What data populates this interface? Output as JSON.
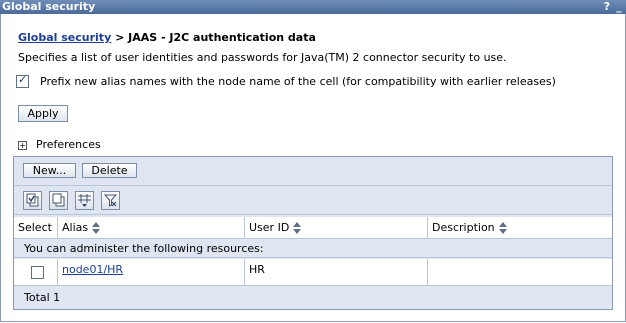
{
  "window": {
    "title": "Global security",
    "help_icon": "?",
    "minimize_icon": "_"
  },
  "breadcrumb": {
    "link": "Global security",
    "separator": " > ",
    "current": "JAAS - J2C authentication data"
  },
  "description": "Specifies a list of user identities and passwords for Java(TM) 2 connector security to use.",
  "prefix_option": {
    "checked": true,
    "label": "Prefix new alias names with the node name of the cell (for compatibility with earlier releases)"
  },
  "apply_label": "Apply",
  "preferences_label": "Preferences",
  "toolbar": {
    "new_label": "New...",
    "delete_label": "Delete"
  },
  "icons": [
    "select-all-icon",
    "deselect-all-icon",
    "show-filter-icon",
    "clear-filter-icon"
  ],
  "table": {
    "columns": [
      "Select",
      "Alias",
      "User ID",
      "Description"
    ],
    "info_row": "You can administer the following resources:",
    "rows": [
      {
        "selected": false,
        "alias": "node01/HR",
        "user_id": "HR",
        "description": ""
      }
    ],
    "total_label": "Total 1"
  }
}
